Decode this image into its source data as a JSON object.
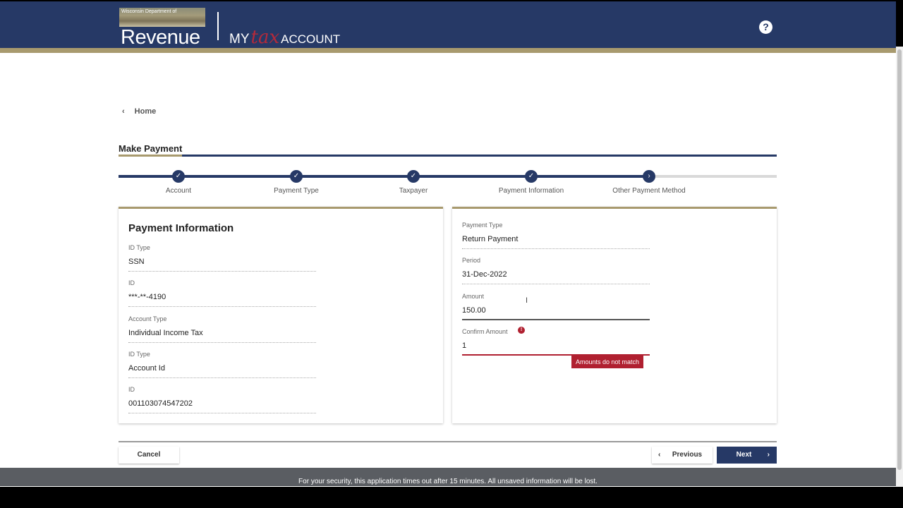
{
  "header": {
    "dept_text": "Wisconsin Department of",
    "logo_word": "Revenue",
    "app_my": "MY",
    "app_tax": "tax",
    "app_account": "ACCOUNT",
    "help_icon": "?"
  },
  "breadcrumb": {
    "chevron": "‹",
    "label": "Home"
  },
  "page": {
    "title": "Make Payment"
  },
  "stepper": {
    "steps": [
      {
        "label": "Account",
        "icon": "✓",
        "state": "complete"
      },
      {
        "label": "Payment Type",
        "icon": "✓",
        "state": "complete"
      },
      {
        "label": "Taxpayer",
        "icon": "✓",
        "state": "complete"
      },
      {
        "label": "Payment Information",
        "icon": "✓",
        "state": "complete"
      },
      {
        "label": "Other Payment Method",
        "icon": "›",
        "state": "current"
      }
    ]
  },
  "left_card": {
    "title": "Payment Information",
    "fields": [
      {
        "label": "ID Type",
        "value": "SSN"
      },
      {
        "label": "ID",
        "value": "***-**-4190"
      },
      {
        "label": "Account Type",
        "value": "Individual Income Tax"
      },
      {
        "label": "ID Type",
        "value": "Account Id"
      },
      {
        "label": "ID",
        "value": "001103074547202"
      }
    ]
  },
  "right_card": {
    "fields": [
      {
        "label": "Payment Type",
        "value": "Return Payment"
      },
      {
        "label": "Period",
        "value": "31-Dec-2022"
      },
      {
        "label": "Amount",
        "value": "150.00"
      },
      {
        "label": "Confirm Amount",
        "value": "1"
      }
    ],
    "error_icon": "!",
    "error_message": "Amounts do not match",
    "text_cursor": "I"
  },
  "actions": {
    "cancel": "Cancel",
    "previous": "Previous",
    "next": "Next",
    "chev_left": "‹",
    "chev_right": "›"
  },
  "footer": {
    "text": "For your security, this application times out after 15 minutes. All unsaved information will be lost."
  },
  "colors": {
    "navy": "#263966",
    "gold": "#a89a6e",
    "error": "#b02030",
    "footer": "#5a5d62"
  }
}
